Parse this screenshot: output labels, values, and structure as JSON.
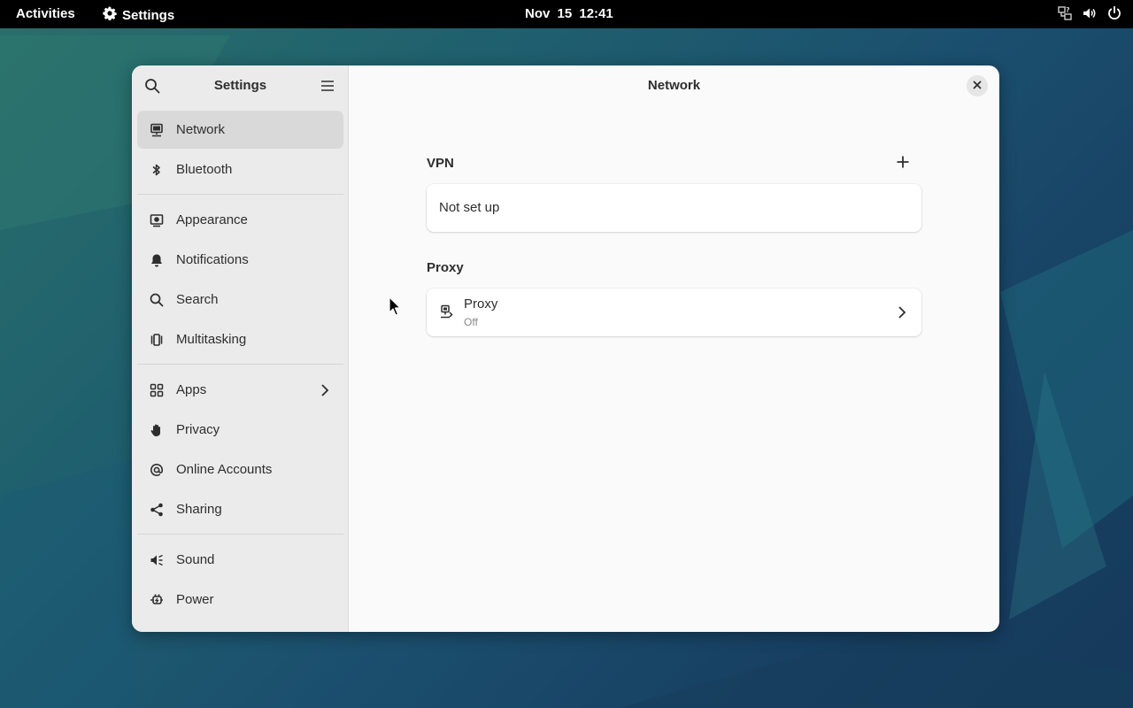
{
  "topbar": {
    "activities_label": "Activities",
    "app_name": "Settings",
    "clock": "Nov 15  12:41",
    "tray_icons": [
      "network-unknown-icon",
      "volume-icon",
      "power-icon"
    ]
  },
  "sidebar": {
    "title": "Settings",
    "groups": [
      [
        {
          "label": "Network",
          "icon": "network-wired-icon",
          "active": true
        },
        {
          "label": "Bluetooth",
          "icon": "bluetooth-icon"
        }
      ],
      [
        {
          "label": "Appearance",
          "icon": "appearance-icon"
        },
        {
          "label": "Notifications",
          "icon": "bell-icon"
        },
        {
          "label": "Search",
          "icon": "search-icon"
        },
        {
          "label": "Multitasking",
          "icon": "multitasking-icon"
        }
      ],
      [
        {
          "label": "Apps",
          "icon": "apps-grid-icon",
          "has_submenu": true
        },
        {
          "label": "Privacy",
          "icon": "hand-icon"
        },
        {
          "label": "Online Accounts",
          "icon": "at-sign-icon"
        },
        {
          "label": "Sharing",
          "icon": "share-icon"
        }
      ],
      [
        {
          "label": "Sound",
          "icon": "speaker-icon"
        },
        {
          "label": "Power",
          "icon": "power-plug-icon"
        }
      ]
    ]
  },
  "content": {
    "title": "Network",
    "vpn": {
      "section_title": "VPN",
      "status": "Not set up"
    },
    "proxy": {
      "section_title": "Proxy",
      "row_title": "Proxy",
      "row_subtitle": "Off"
    }
  },
  "colors": {
    "topbar_bg": "#000000",
    "sidebar_bg": "#ebebeb",
    "content_bg": "#fafafa",
    "active_item_bg": "#d9d9d9",
    "text": "#2e2e2e",
    "subtext": "#8a8a8a"
  }
}
